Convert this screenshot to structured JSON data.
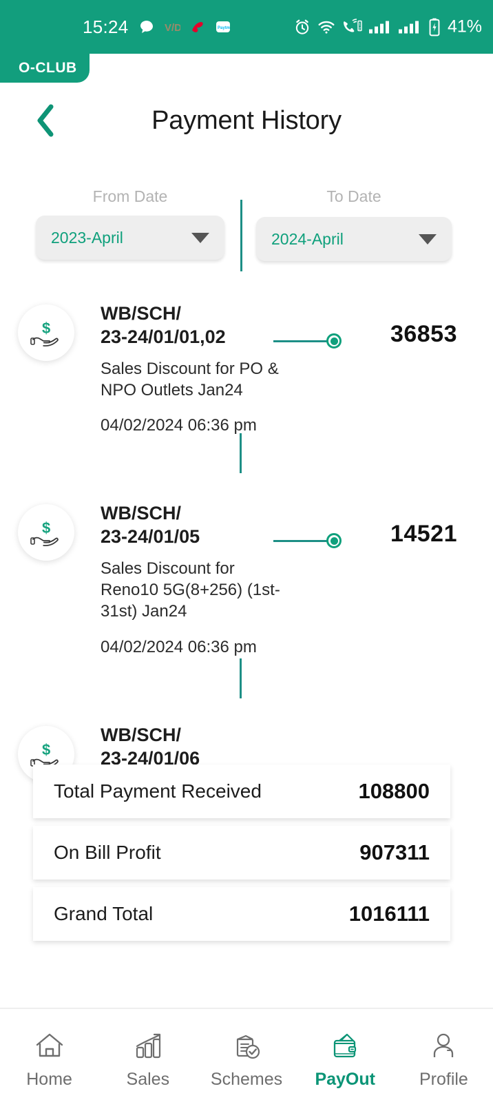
{
  "status_bar": {
    "time": "15:24",
    "battery_text": "41%",
    "notification_icons": [
      "chat-bubble-icon",
      "vd-logo-icon",
      "airtel-logo-icon",
      "paytm-logo-icon"
    ],
    "system_icons": [
      "alarm-icon",
      "wifi-icon",
      "vowifi-dual-sim-icon",
      "signal-bars-sim1-icon",
      "signal-bars-sim2-icon",
      "battery-charging-icon"
    ],
    "background_color": "#129e7d"
  },
  "app_tab": {
    "label": "O-CLUB"
  },
  "header": {
    "title": "Payment History",
    "back_icon": "chevron-left-icon"
  },
  "filters": {
    "from": {
      "label": "From Date",
      "value": "2023-April",
      "caret_icon": "caret-down-icon"
    },
    "to": {
      "label": "To Date",
      "value": "2024-April",
      "caret_icon": "caret-down-icon"
    }
  },
  "transactions": [
    {
      "reference": "WB/SCH/\n23-24/01/01,02",
      "description": "Sales Discount for PO & NPO Outlets Jan24",
      "datetime": "04/02/2024 06:36 pm",
      "amount": "36853",
      "icon": "hand-holding-dollar-icon"
    },
    {
      "reference": "WB/SCH/\n23-24/01/05",
      "description": "Sales Discount for Reno10 5G(8+256) (1st-31st) Jan24",
      "datetime": "04/02/2024 06:36 pm",
      "amount": "14521",
      "icon": "hand-holding-dollar-icon"
    },
    {
      "reference": "WB/SCH/\n23-24/01/06",
      "description": "",
      "datetime": "",
      "amount": "",
      "icon": "hand-holding-dollar-icon"
    }
  ],
  "summary": [
    {
      "label": "Total Payment Received",
      "value": "108800"
    },
    {
      "label": "On Bill Profit",
      "value": "907311"
    },
    {
      "label": "Grand Total",
      "value": "1016111"
    }
  ],
  "bottom_nav": {
    "items": [
      {
        "label": "Home",
        "icon": "home-icon",
        "active": false
      },
      {
        "label": "Sales",
        "icon": "bar-chart-growth-icon",
        "active": false
      },
      {
        "label": "Schemes",
        "icon": "document-check-icon",
        "active": false
      },
      {
        "label": "PayOut",
        "icon": "wallet-icon",
        "active": true
      },
      {
        "label": "Profile",
        "icon": "person-icon",
        "active": false
      }
    ]
  },
  "colors": {
    "brand_teal": "#129e7d",
    "accent_green": "#0fa07c",
    "timeline_line": "#1d8f86",
    "text_dark": "#1a1a1a",
    "muted": "#b3b3b3"
  }
}
